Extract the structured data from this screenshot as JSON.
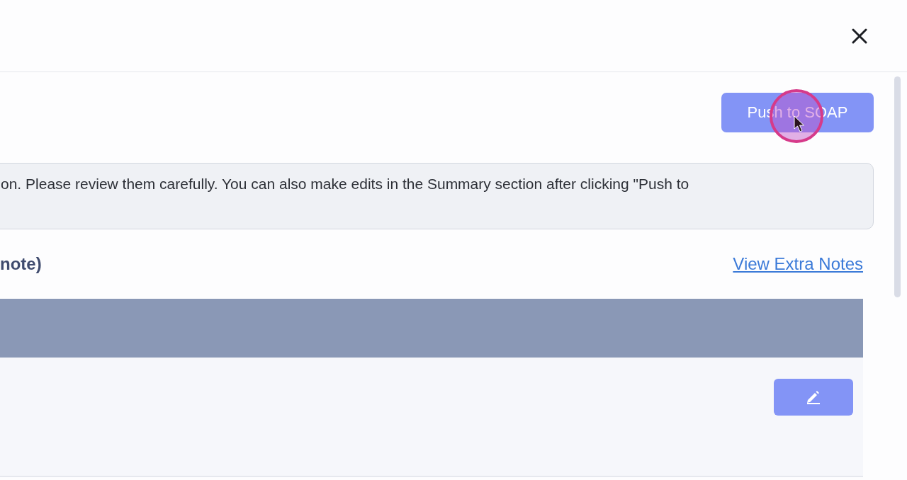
{
  "push_button": {
    "label": "Push to SOAP"
  },
  "notice": {
    "text": "on. Please review them carefully. You can also make edits in the Summary section after clicking \"Push to"
  },
  "section": {
    "title": "note)",
    "link": "View Extra Notes"
  },
  "table": {
    "rows": [
      {
        "kind": "editable"
      }
    ]
  }
}
